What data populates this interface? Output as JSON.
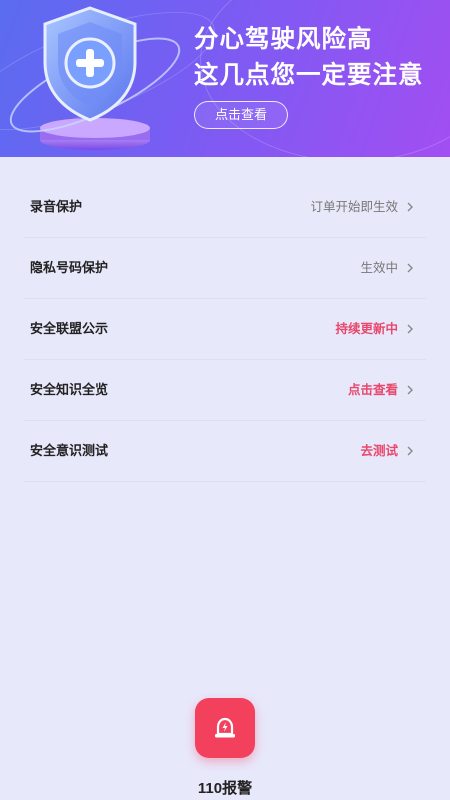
{
  "banner": {
    "headline_line1": "分心驾驶风险高",
    "headline_line2": "这几点您一定要注意",
    "cta_label": "点击查看",
    "icon": "shield-plus-icon",
    "colors": {
      "gradient_start": "#5a6cf0",
      "gradient_end": "#a24ef2"
    }
  },
  "items": [
    {
      "label": "录音保护",
      "value": "订单开始即生效",
      "highlight": false
    },
    {
      "label": "隐私号码保护",
      "value": "生效中",
      "highlight": false
    },
    {
      "label": "安全联盟公示",
      "value": "持续更新中",
      "highlight": true
    },
    {
      "label": "安全知识全览",
      "value": "点击查看",
      "highlight": true
    },
    {
      "label": "安全意识测试",
      "value": "去测试",
      "highlight": true
    }
  ],
  "sos": {
    "label": "110报警",
    "icon": "alarm-light-icon",
    "color": "#f2405d"
  },
  "colors": {
    "highlight": "#e8486c",
    "background": "#e8e8fb"
  }
}
